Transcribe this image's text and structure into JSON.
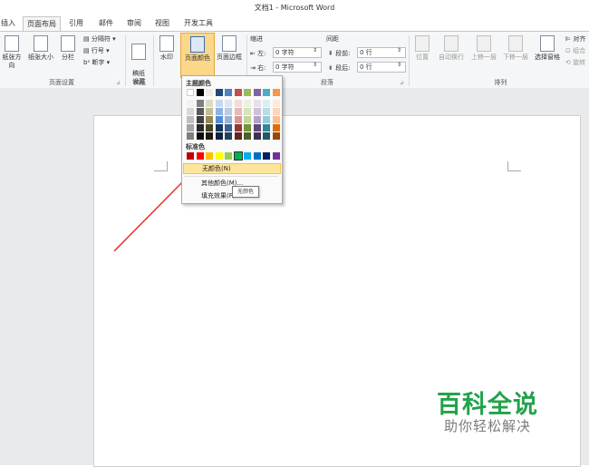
{
  "window": {
    "title": "文档1 - Microsoft Word"
  },
  "tabs": [
    "插入",
    "页面布局",
    "引用",
    "邮件",
    "审阅",
    "视图",
    "开发工具"
  ],
  "active_tab": "页面布局",
  "ribbon": {
    "page_setup": {
      "orientation": "纸张方向",
      "size": "纸张大小",
      "columns": "分栏",
      "breaks": "分隔符",
      "line_numbers": "行号",
      "hyphenation": "断字",
      "group_label": "页面设置"
    },
    "manuscript": {
      "button": "稿纸\n设置",
      "group_label": "稿纸"
    },
    "page_background": {
      "watermark": "水印",
      "page_color": "页面颜色",
      "page_borders": "页面边框"
    },
    "paragraph": {
      "indent_header": "缩进",
      "spacing_header": "间距",
      "indent_left_label": "左:",
      "indent_left_value": "0 字符",
      "indent_right_label": "右:",
      "indent_right_value": "0 字符",
      "space_before_label": "段前:",
      "space_before_value": "0 行",
      "space_after_label": "段后:",
      "space_after_value": "0 行",
      "group_label": "段落"
    },
    "arrange": {
      "position": "位置",
      "wrap_text": "自动换行",
      "bring_forward": "上移一层",
      "send_backward": "下移一层",
      "selection_pane": "选择窗格",
      "align": "对齐",
      "group": "组合",
      "rotate": "旋转",
      "group_label": "排列"
    }
  },
  "color_menu": {
    "theme_header": "主题颜色",
    "standard_header": "标准色",
    "theme_top_row": [
      "#ffffff",
      "#000000",
      "#eeece1",
      "#1f497d",
      "#4f81bd",
      "#c0504d",
      "#9bbb59",
      "#8064a2",
      "#4bacc6",
      "#f79646"
    ],
    "theme_shades": [
      [
        "#f2f2f2",
        "#7f7f7f",
        "#ddd9c3",
        "#c6d9f0",
        "#dbe5f1",
        "#f2dcdb",
        "#ebf1dd",
        "#e5e0ec",
        "#dbeef3",
        "#fdeada"
      ],
      [
        "#d8d8d8",
        "#595959",
        "#c4bd97",
        "#8db3e2",
        "#b8cce4",
        "#e5b9b7",
        "#d7e3bc",
        "#ccc1d9",
        "#b7dde8",
        "#fbd5b5"
      ],
      [
        "#bfbfbf",
        "#3f3f3f",
        "#938953",
        "#548dd4",
        "#95b3d7",
        "#d99694",
        "#c3d69b",
        "#b2a2c7",
        "#92cddc",
        "#fac08f"
      ],
      [
        "#a5a5a5",
        "#262626",
        "#494429",
        "#17365d",
        "#366092",
        "#953734",
        "#76923c",
        "#5f497a",
        "#31859b",
        "#e36c09"
      ],
      [
        "#7f7f7f",
        "#0c0c0c",
        "#1d1b10",
        "#0f243e",
        "#244061",
        "#632423",
        "#4f6128",
        "#3f3151",
        "#205867",
        "#974806"
      ]
    ],
    "standard_colors": [
      "#c00000",
      "#ff0000",
      "#ffc000",
      "#ffff00",
      "#92d050",
      "#00b050",
      "#00b0f0",
      "#0070c0",
      "#002060",
      "#7030a0"
    ],
    "items": {
      "no_color": "无颜色(N)",
      "more_colors": "其他颜色(M)...",
      "fill_effects": "填充效果(F)..."
    }
  },
  "tooltip": "无颜色",
  "watermark": {
    "line1": "百科全说",
    "line2": "助你轻松解决"
  }
}
